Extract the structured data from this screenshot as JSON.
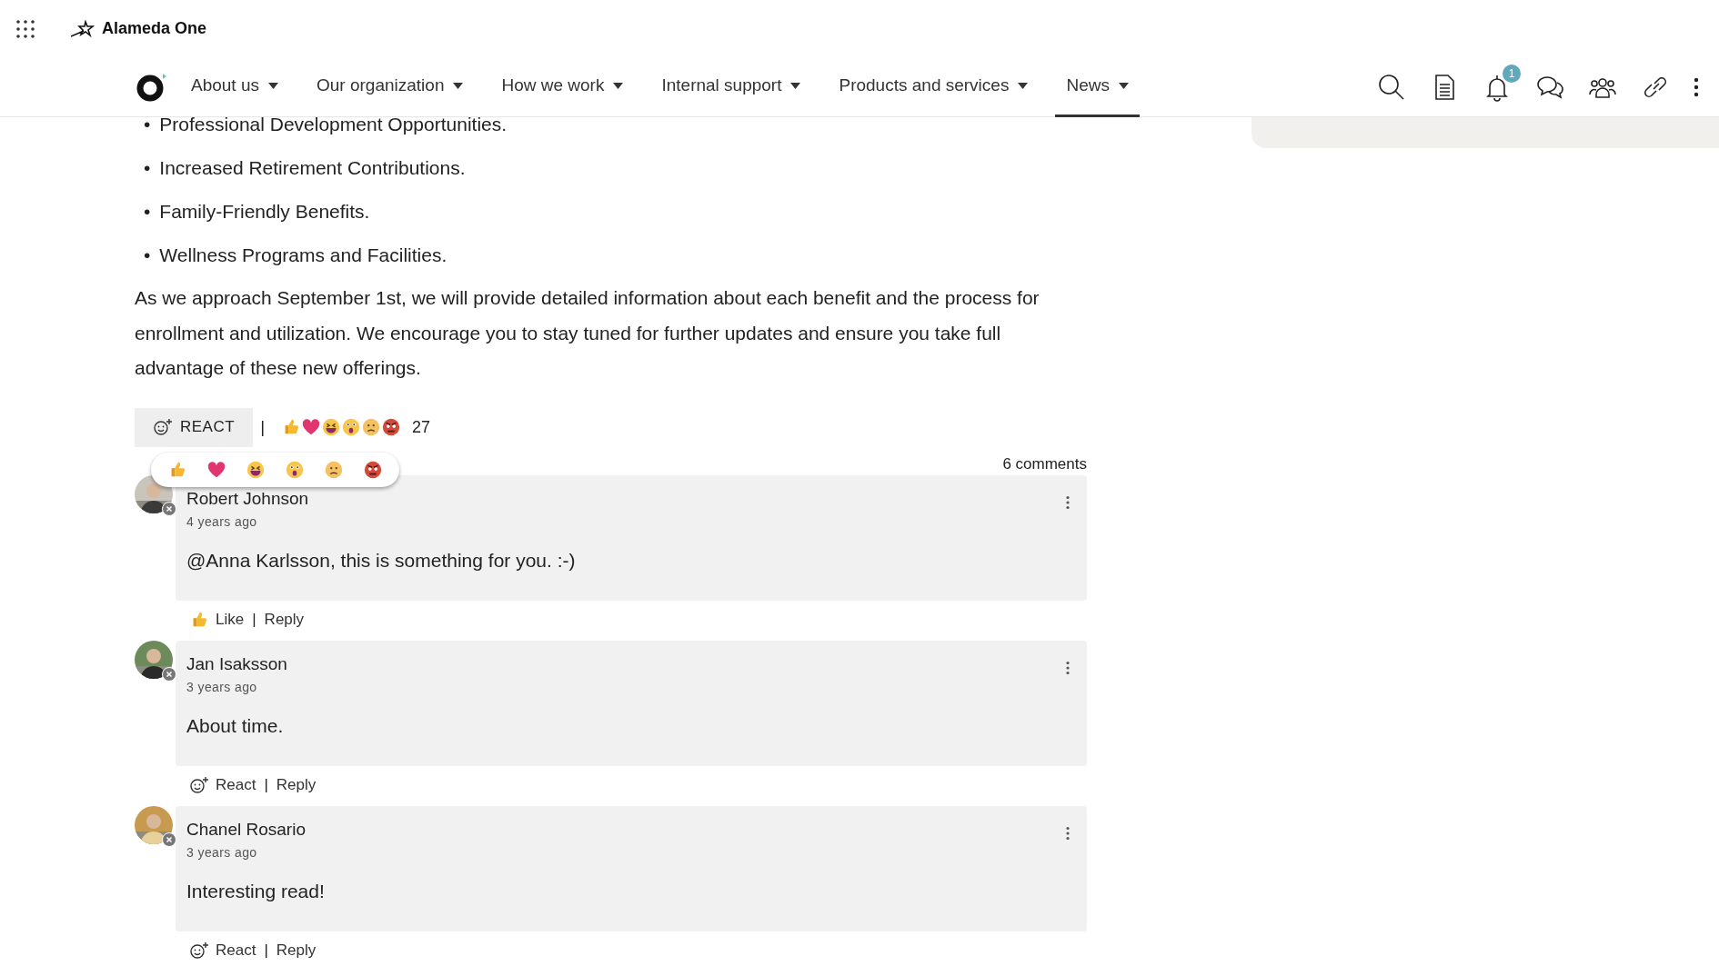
{
  "app": {
    "title": "Alameda One"
  },
  "nav": {
    "items": [
      {
        "label": "About us",
        "selected": false
      },
      {
        "label": "Our organization",
        "selected": false
      },
      {
        "label": "How we work",
        "selected": false
      },
      {
        "label": "Internal support",
        "selected": false
      },
      {
        "label": "Products and services",
        "selected": false
      },
      {
        "label": "News",
        "selected": true
      }
    ],
    "notification_count": "1"
  },
  "article": {
    "bullets": [
      {
        "marker": "•",
        "text": "Professional Development Opportunities."
      },
      {
        "marker": "•",
        "text": "Increased Retirement Contributions."
      },
      {
        "marker": "•",
        "text": "Family-Friendly Benefits."
      },
      {
        "marker": "•",
        "text": "Wellness Programs and Facilities."
      }
    ],
    "paragraph": "As we approach September 1st, we will provide detailed information about each benefit and the process for enrollment and utilization. We encourage you to stay tuned for further updates and ensure you take full advantage of these new offerings."
  },
  "reactions": {
    "button": "REACT",
    "separator": "|",
    "count": "27",
    "picker_open": true
  },
  "comments_count": "6 comments",
  "comments": [
    {
      "author": "Robert Johnson",
      "time": "4 years ago",
      "text": "@Anna Karlsson, this is something for you. :-)",
      "kind": "like",
      "action": "Like",
      "divider": "|",
      "reply": "Reply"
    },
    {
      "author": "Jan Isaksson",
      "time": "3 years ago",
      "text": "About time.",
      "kind": "react",
      "action": "React",
      "divider": "|",
      "reply": "Reply"
    },
    {
      "author": "Chanel Rosario",
      "time": "3 years ago",
      "text": "Interesting read!",
      "kind": "react",
      "action": "React",
      "divider": "|",
      "reply": "Reply"
    }
  ]
}
